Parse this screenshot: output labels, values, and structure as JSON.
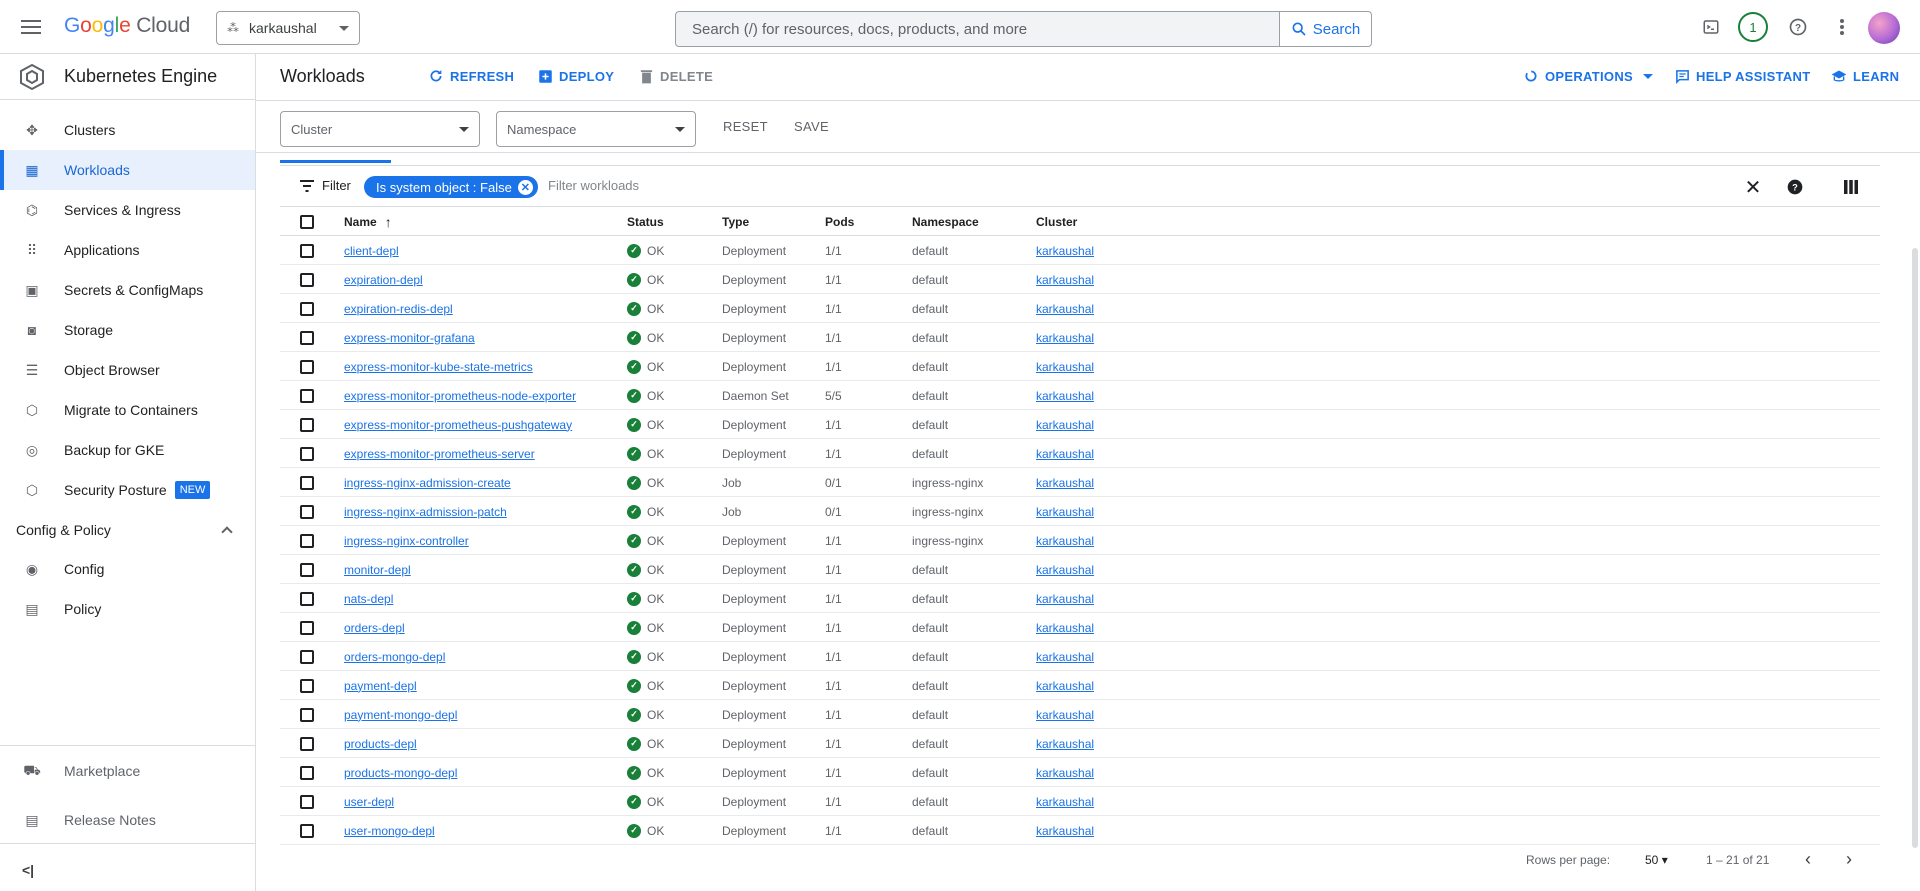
{
  "topbar": {
    "logo_google": [
      "G",
      "o",
      "o",
      "g",
      "l",
      "e"
    ],
    "logo_cloud": "Cloud",
    "project": "karkaushal",
    "search_placeholder": "Search (/) for resources, docs, products, and more",
    "search_button": "Search",
    "notifications": "1"
  },
  "sidebar": {
    "product_name": "Kubernetes Engine",
    "items": [
      {
        "label": "Clusters",
        "icon": "clusters-icon"
      },
      {
        "label": "Workloads",
        "icon": "workloads-icon",
        "active": true
      },
      {
        "label": "Services & Ingress",
        "icon": "services-icon"
      },
      {
        "label": "Applications",
        "icon": "applications-icon"
      },
      {
        "label": "Secrets & ConfigMaps",
        "icon": "secrets-icon"
      },
      {
        "label": "Storage",
        "icon": "storage-icon"
      },
      {
        "label": "Object Browser",
        "icon": "object-browser-icon"
      },
      {
        "label": "Migrate to Containers",
        "icon": "migrate-icon"
      },
      {
        "label": "Backup for GKE",
        "icon": "backup-icon"
      },
      {
        "label": "Security Posture",
        "icon": "security-icon",
        "badge": "NEW"
      }
    ],
    "section": "Config & Policy",
    "section_items": [
      {
        "label": "Config",
        "icon": "config-icon"
      },
      {
        "label": "Policy",
        "icon": "policy-icon"
      }
    ],
    "footer_items": [
      {
        "label": "Marketplace",
        "icon": "marketplace-icon"
      },
      {
        "label": "Release Notes",
        "icon": "release-notes-icon"
      }
    ],
    "collapse": "<|"
  },
  "header": {
    "title": "Workloads",
    "refresh": "REFRESH",
    "deploy": "DEPLOY",
    "delete": "DELETE",
    "operations": "OPERATIONS",
    "help_assistant": "HELP ASSISTANT",
    "learn": "LEARN"
  },
  "filters": {
    "cluster_placeholder": "Cluster",
    "namespace_placeholder": "Namespace",
    "reset": "RESET",
    "save": "SAVE"
  },
  "filter_bar": {
    "label": "Filter",
    "chip": "Is system object : False",
    "input_placeholder": "Filter workloads"
  },
  "table": {
    "columns": [
      "Name",
      "Status",
      "Type",
      "Pods",
      "Namespace",
      "Cluster"
    ],
    "rows": [
      {
        "name": "client-depl",
        "status": "OK",
        "type": "Deployment",
        "pods": "1/1",
        "namespace": "default",
        "cluster": "karkaushal"
      },
      {
        "name": "expiration-depl",
        "status": "OK",
        "type": "Deployment",
        "pods": "1/1",
        "namespace": "default",
        "cluster": "karkaushal"
      },
      {
        "name": "expiration-redis-depl",
        "status": "OK",
        "type": "Deployment",
        "pods": "1/1",
        "namespace": "default",
        "cluster": "karkaushal"
      },
      {
        "name": "express-monitor-grafana",
        "status": "OK",
        "type": "Deployment",
        "pods": "1/1",
        "namespace": "default",
        "cluster": "karkaushal"
      },
      {
        "name": "express-monitor-kube-state-metrics",
        "status": "OK",
        "type": "Deployment",
        "pods": "1/1",
        "namespace": "default",
        "cluster": "karkaushal"
      },
      {
        "name": "express-monitor-prometheus-node-exporter",
        "status": "OK",
        "type": "Daemon Set",
        "pods": "5/5",
        "namespace": "default",
        "cluster": "karkaushal"
      },
      {
        "name": "express-monitor-prometheus-pushgateway",
        "status": "OK",
        "type": "Deployment",
        "pods": "1/1",
        "namespace": "default",
        "cluster": "karkaushal"
      },
      {
        "name": "express-monitor-prometheus-server",
        "status": "OK",
        "type": "Deployment",
        "pods": "1/1",
        "namespace": "default",
        "cluster": "karkaushal"
      },
      {
        "name": "ingress-nginx-admission-create",
        "status": "OK",
        "type": "Job",
        "pods": "0/1",
        "namespace": "ingress-nginx",
        "cluster": "karkaushal"
      },
      {
        "name": "ingress-nginx-admission-patch",
        "status": "OK",
        "type": "Job",
        "pods": "0/1",
        "namespace": "ingress-nginx",
        "cluster": "karkaushal"
      },
      {
        "name": "ingress-nginx-controller",
        "status": "OK",
        "type": "Deployment",
        "pods": "1/1",
        "namespace": "ingress-nginx",
        "cluster": "karkaushal"
      },
      {
        "name": "monitor-depl",
        "status": "OK",
        "type": "Deployment",
        "pods": "1/1",
        "namespace": "default",
        "cluster": "karkaushal"
      },
      {
        "name": "nats-depl",
        "status": "OK",
        "type": "Deployment",
        "pods": "1/1",
        "namespace": "default",
        "cluster": "karkaushal"
      },
      {
        "name": "orders-depl",
        "status": "OK",
        "type": "Deployment",
        "pods": "1/1",
        "namespace": "default",
        "cluster": "karkaushal"
      },
      {
        "name": "orders-mongo-depl",
        "status": "OK",
        "type": "Deployment",
        "pods": "1/1",
        "namespace": "default",
        "cluster": "karkaushal"
      },
      {
        "name": "payment-depl",
        "status": "OK",
        "type": "Deployment",
        "pods": "1/1",
        "namespace": "default",
        "cluster": "karkaushal"
      },
      {
        "name": "payment-mongo-depl",
        "status": "OK",
        "type": "Deployment",
        "pods": "1/1",
        "namespace": "default",
        "cluster": "karkaushal"
      },
      {
        "name": "products-depl",
        "status": "OK",
        "type": "Deployment",
        "pods": "1/1",
        "namespace": "default",
        "cluster": "karkaushal"
      },
      {
        "name": "products-mongo-depl",
        "status": "OK",
        "type": "Deployment",
        "pods": "1/1",
        "namespace": "default",
        "cluster": "karkaushal"
      },
      {
        "name": "user-depl",
        "status": "OK",
        "type": "Deployment",
        "pods": "1/1",
        "namespace": "default",
        "cluster": "karkaushal"
      },
      {
        "name": "user-mongo-depl",
        "status": "OK",
        "type": "Deployment",
        "pods": "1/1",
        "namespace": "default",
        "cluster": "karkaushal"
      }
    ]
  },
  "pagination": {
    "rows_per_page_label": "Rows per page:",
    "rows_per_page": "50",
    "range": "1 – 21 of 21"
  },
  "colors": {
    "accent": "#1a73e8",
    "ok": "#188038"
  }
}
